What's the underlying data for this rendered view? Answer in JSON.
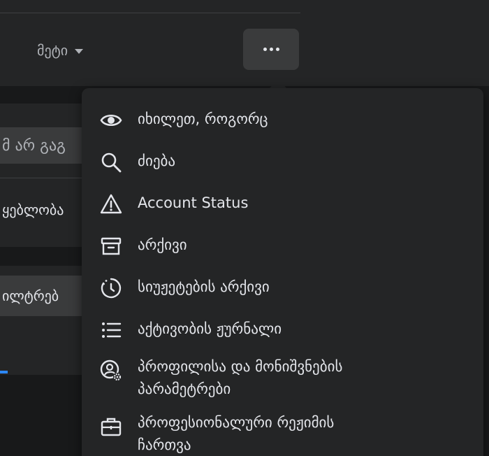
{
  "nav": {
    "more_label": "მეტი",
    "dots_label": "•••"
  },
  "left_panel": {
    "search_fragment": "მ არ გაგ",
    "item1_fragment": "ყებლობა",
    "filter_fragment": "ილტრებ"
  },
  "menu": {
    "items": [
      {
        "label": "იხილეთ, როგორც",
        "icon": "eye-icon"
      },
      {
        "label": "ძიება",
        "icon": "search-icon"
      },
      {
        "label": "Account Status",
        "icon": "warning-icon"
      },
      {
        "label": "არქივი",
        "icon": "archive-icon"
      },
      {
        "label": "სიუჟეტების არქივი",
        "icon": "story-archive-icon"
      },
      {
        "label": "აქტივობის ჟურნალი",
        "icon": "list-icon"
      },
      {
        "label_line1": "პროფილისა და მონიშვნების",
        "label_line2": "პარამეტრები",
        "icon": "profile-settings-icon"
      },
      {
        "label_line1": "პროფესიონალური რეჟიმის",
        "label_line2": "ჩართვა",
        "icon": "briefcase-icon"
      }
    ]
  },
  "colors": {
    "background": "#18191a",
    "surface": "#242526",
    "button": "#3a3b3c",
    "text": "#e4e6eb",
    "muted": "#b0b3b8",
    "accent": "#2d88ff"
  }
}
